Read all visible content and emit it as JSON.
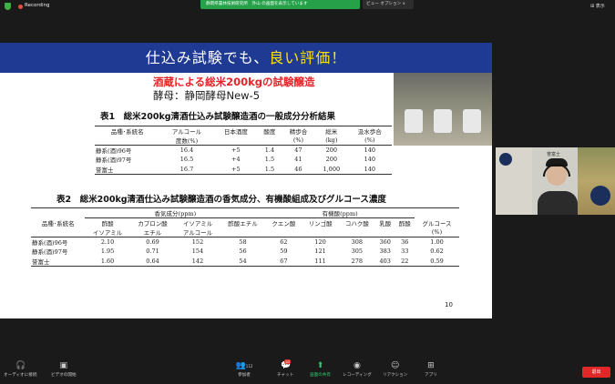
{
  "topbar": {
    "recording_label": "Recording",
    "share_banner": "静岡県農林技術研究所　外山 の画面を表示しています",
    "view_options": "ビュー オプション ∨",
    "view_button": "表示"
  },
  "slide": {
    "header_prefix": "仕込み試験でも、",
    "header_highlight": "良い評価！",
    "subtitle1": "酒蔵による総米200kgの試験醸造",
    "subtitle2": "酵母：静岡酵母New-5",
    "table1": {
      "title": "表1　総米200kg清酒仕込み試験醸造酒の一般成分分析結果",
      "headers_top": [
        "品種･系統名",
        "アルコール",
        "日本酒度",
        "酸度",
        "精歩合",
        "総米",
        "汲水歩合"
      ],
      "headers_bottom": [
        "",
        "度数(%)",
        "",
        "",
        "(%)",
        "(kg)",
        "(%)"
      ],
      "rows": [
        [
          "静系(酒)96号",
          "16.4",
          "+5",
          "1.4",
          "47",
          "200",
          "140"
        ],
        [
          "静系(酒)97号",
          "16.5",
          "+4",
          "1.5",
          "41",
          "200",
          "140"
        ],
        [
          "誉富士",
          "16.7",
          "+5",
          "1.5",
          "46",
          "1,000",
          "140"
        ]
      ]
    },
    "table2": {
      "title": "表2　総米200kg清酒仕込み試験醸造酒の香気成分、有機酸組成及びグルコース濃度",
      "group_aroma": "香気成分(ppm)",
      "group_acid": "有機酸(ppm)",
      "headers_top": [
        "品種･系統名",
        "酢酸",
        "カプロン酸",
        "イソアミル",
        "酢酸エチル",
        "クエン酸",
        "リンゴ酸",
        "コハク酸",
        "乳酸",
        "酢酸",
        "グルコース"
      ],
      "headers_bottom": [
        "",
        "イソアミル",
        "エチル",
        "アルコール",
        "",
        "",
        "",
        "",
        "",
        "",
        "(%)"
      ],
      "rows": [
        [
          "静系(酒)96号",
          "2.10",
          "0.69",
          "152",
          "58",
          "62",
          "120",
          "308",
          "360",
          "36",
          "1.00"
        ],
        [
          "静系(酒)97号",
          "1.95",
          "0.71",
          "154",
          "56",
          "59",
          "121",
          "305",
          "383",
          "33",
          "0.62"
        ],
        [
          "誉富士",
          "1.60",
          "0.64",
          "142",
          "54",
          "67",
          "111",
          "278",
          "403",
          "22",
          "0.59"
        ]
      ]
    },
    "page_number": "10"
  },
  "webcam": {
    "name": "誉富士"
  },
  "bottombar": {
    "audio": "オーディオに接続",
    "video": "ビデオの開始",
    "participants": "参加者",
    "participants_count": "112",
    "chat": "チャット",
    "chat_badge": "10",
    "share": "画面の共有",
    "record": "レコーディング",
    "reactions": "リアクション",
    "apps": "アプリ",
    "leave": "退出"
  },
  "colors": {
    "header_bg": "#1f3a93",
    "highlight": "#ffe600",
    "subtitle_red": "#e8242a",
    "banner_green": "#26a14a",
    "leave_red": "#e02828"
  }
}
